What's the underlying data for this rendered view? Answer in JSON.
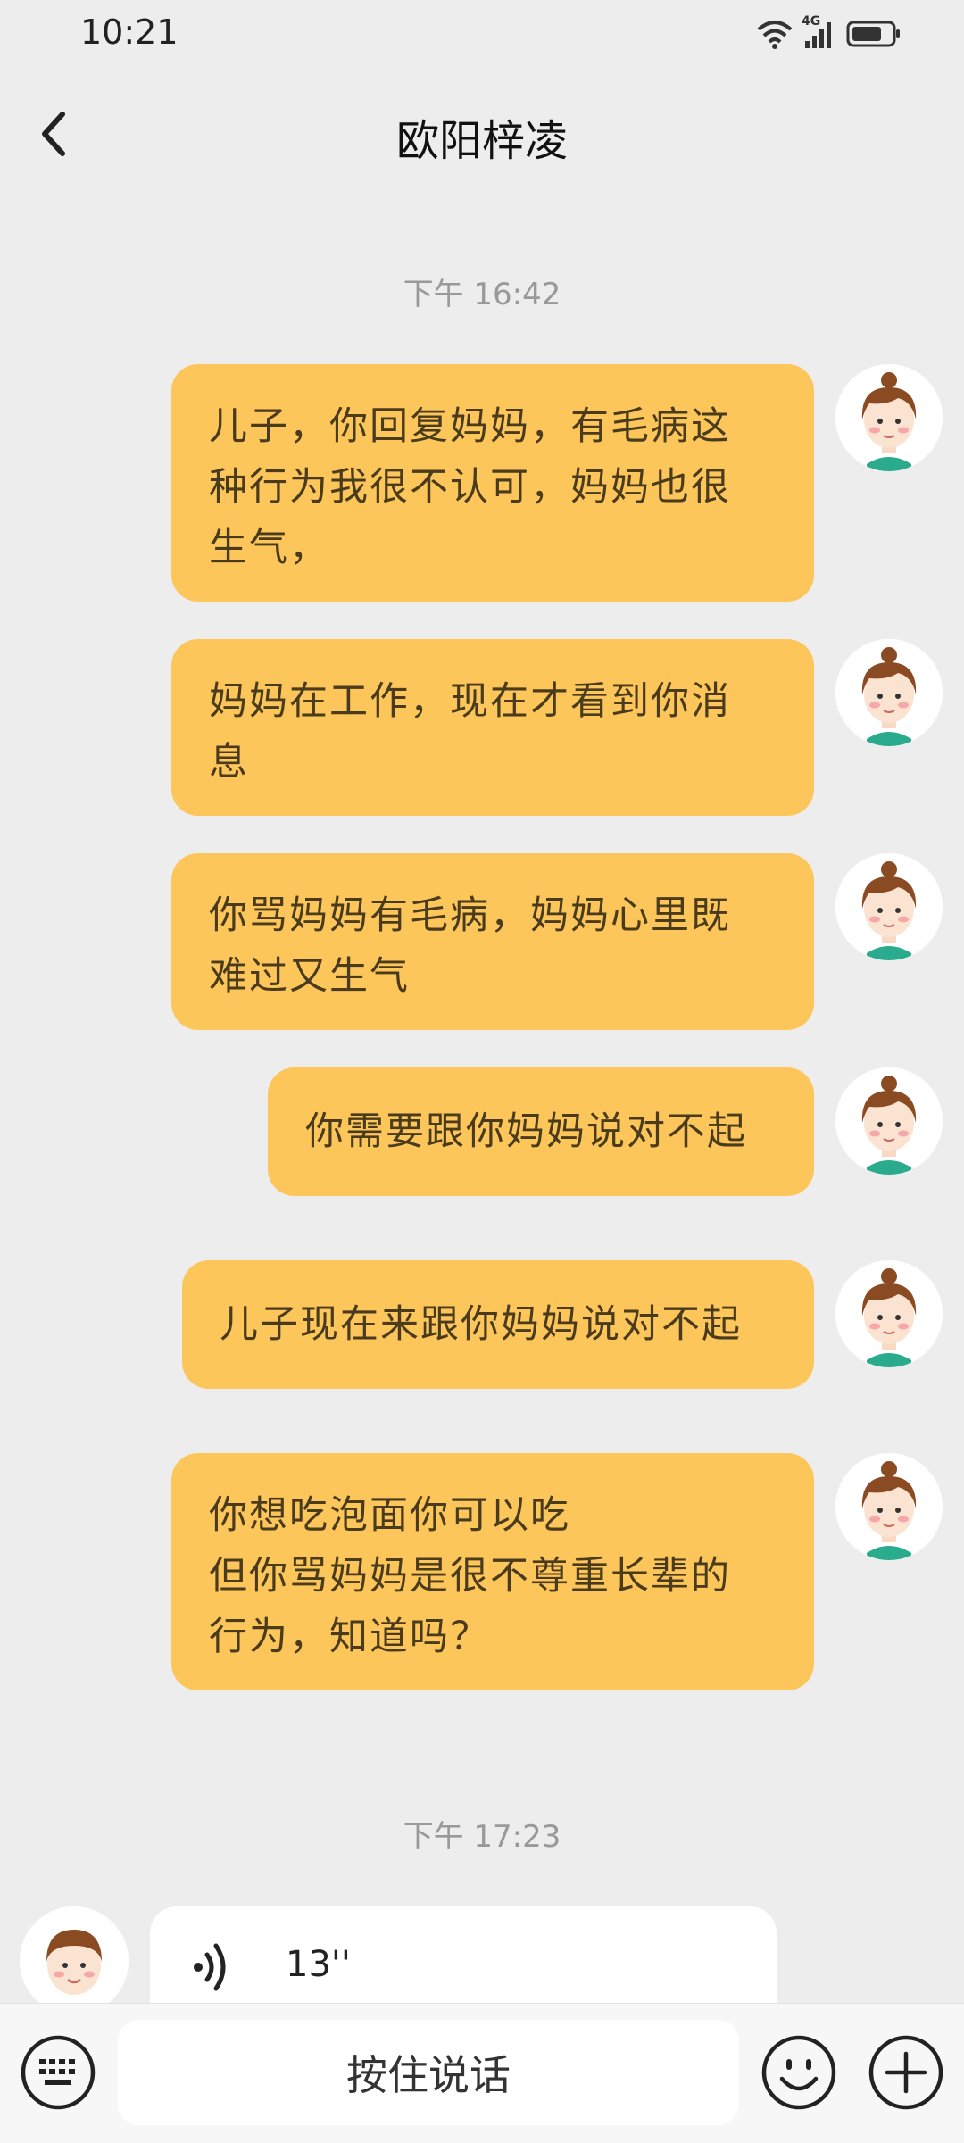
{
  "status_bar": {
    "time": "10:21",
    "network": "4G"
  },
  "header": {
    "title": "欧阳梓凌"
  },
  "timestamps": [
    "下午 16:42",
    "下午 17:23"
  ],
  "messages": [
    {
      "text": "儿子，你回复妈妈，有毛病这\n种行为我很不认可，妈妈也很\n生气，"
    },
    {
      "text": "妈妈在工作，现在才看到你消\n息"
    },
    {
      "text": "你骂妈妈有毛病，妈妈心里既\n难过又生气"
    },
    {
      "text": "你需要跟你妈妈说对不起"
    },
    {
      "text": "儿子现在来跟你妈妈说对不起"
    },
    {
      "text": "你想吃泡面你可以吃\n但你骂妈妈是很不尊重长辈的\n行为，知道吗？"
    }
  ],
  "voice_message": {
    "duration": "13''"
  },
  "input_bar": {
    "hold_to_talk": "按住说话"
  },
  "colors": {
    "bubble": "#fcc65a",
    "background": "#ededed"
  }
}
